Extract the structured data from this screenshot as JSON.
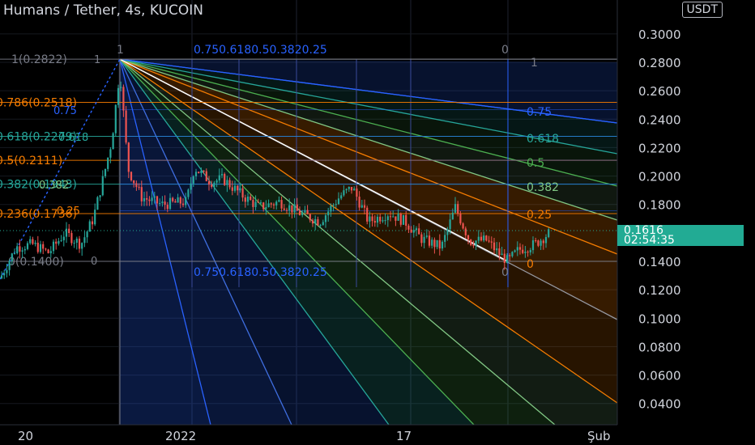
{
  "header": {
    "title": "Humans / Tether, 4s, KUCOIN",
    "currency": "USDT"
  },
  "colors": {
    "background": "#000000",
    "up": "#26a69a",
    "down": "#ef5350",
    "axis_text": "#d1d4dc",
    "price_tag": "#22ab94"
  },
  "price_tag": {
    "value": "0.1616",
    "countdown": "02:54:35"
  },
  "chart_data": {
    "type": "candlestick",
    "title": "Humans / Tether, 4s, KUCOIN",
    "y_ticks": [
      "0.3000",
      "0.2800",
      "0.2600",
      "0.2400",
      "0.2200",
      "0.2000",
      "0.1800",
      "0.1400",
      "0.1200",
      "0.1000",
      "0.0800",
      "0.0600",
      "0.0400"
    ],
    "ylim": [
      0.03,
      0.32
    ],
    "x_ticks": [
      "20",
      "2022",
      "17",
      "Şub"
    ],
    "fib_levels": [
      {
        "label": "1(0.2822)",
        "price": 0.2822
      },
      {
        "label": "0.786(0.2518)",
        "price": 0.2518
      },
      {
        "label": "0.618(0.2279)",
        "price": 0.2279
      },
      {
        "label": "0.5(0.2111)",
        "price": 0.2111
      },
      {
        "label": "0.382(0.1943)",
        "price": 0.1943
      },
      {
        "label": "0.236(0.1736)",
        "price": 0.1736
      },
      {
        "label": "0(0.1400)",
        "price": 0.14
      }
    ],
    "fan_labels": [
      "1",
      "0.75",
      "0.618",
      "0.5",
      "0.382",
      "0.25",
      "0"
    ],
    "top_ratio_text": "0.750.6180.50.3820.25",
    "current_price": 0.1616,
    "grid": true
  }
}
